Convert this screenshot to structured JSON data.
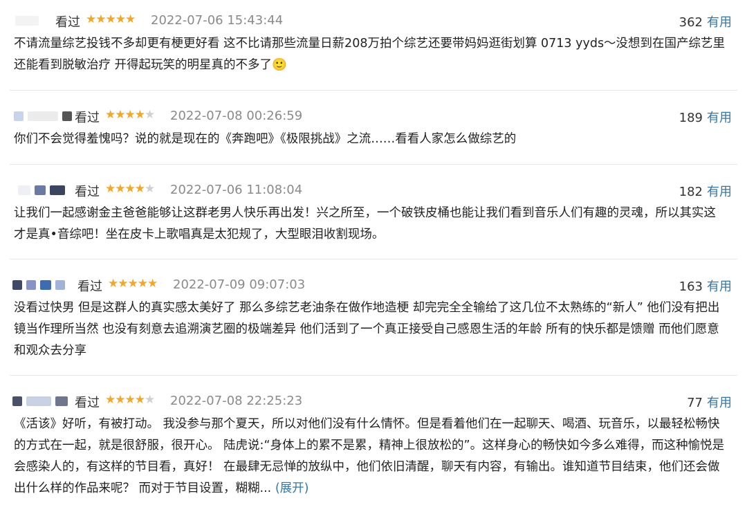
{
  "colors": {
    "star": "#f5a623",
    "star_off": "#d0d0d0",
    "link": "#3377aa",
    "meta": "#8a8a8a"
  },
  "useful_label": "有用",
  "reviews": [
    {
      "status": "看过",
      "rating": 5,
      "time": "2022-07-06 15:43:44",
      "votes": "362",
      "text": "不请流量综艺投钱不多却更有梗更好看 这不比请那些流量日薪208万拍个综艺还要带妈妈逛街划算 0713 yyds～没想到在国产综艺里还能看到脱敏治疗 开得起玩笑的明星真的不多了🙂"
    },
    {
      "status": "看过",
      "rating": 4,
      "time": "2022-07-08 00:26:59",
      "votes": "189",
      "text": "你们不会觉得羞愧吗？说的就是现在的《奔跑吧》《极限挑战》之流……看看人家怎么做综艺的"
    },
    {
      "status": "看过",
      "rating": 4,
      "time": "2022-07-06 11:08:04",
      "votes": "182",
      "text": "让我们一起感谢金主爸爸能够让这群老男人快乐再出发！兴之所至，一个破铁皮桶也能让我们看到音乐人们有趣的灵魂，所以其实这才是真•音综吧！坐在皮卡上歌唱真是太犯规了，大型眼泪收割现场。"
    },
    {
      "status": "看过",
      "rating": 5,
      "time": "2022-07-09 09:07:03",
      "votes": "163",
      "text": "没看过快男 但是这群人的真实感太美好了 那么多综艺老油条在做作地造梗 却完完全全输给了这几位不太熟练的“新人” 他们没有把出镜当作理所当然 也没有刻意去追溯演艺圈的极端差异 他们活到了一个真正接受自己感恩生活的年龄 所有的快乐都是馈赠 而他们愿意和观众去分享"
    },
    {
      "status": "看过",
      "rating": 4,
      "time": "2022-07-08 22:25:23",
      "votes": "77",
      "text": "《活该》好听，有被打动。 我没参与那个夏天，所以对他们没有什么情怀。但是看着他们在一起聊天、喝酒、玩音乐，以最轻松畅快的方式在一起，就是很舒服，很开心。 陆虎说:“身体上的累不是累，精神上很放松的”。这样身心的畅快如今多么难得，而这种愉悦是会感染人的，有这样的节目看，真好！ 在最肆无忌惮的放纵中，他们依旧清醒，聊天有内容，有输出。谁知道节目结束，他们还会做出什么样的作品来呢？ 而对于节目设置，糊糊...",
      "expand_label": "(展开)"
    }
  ]
}
